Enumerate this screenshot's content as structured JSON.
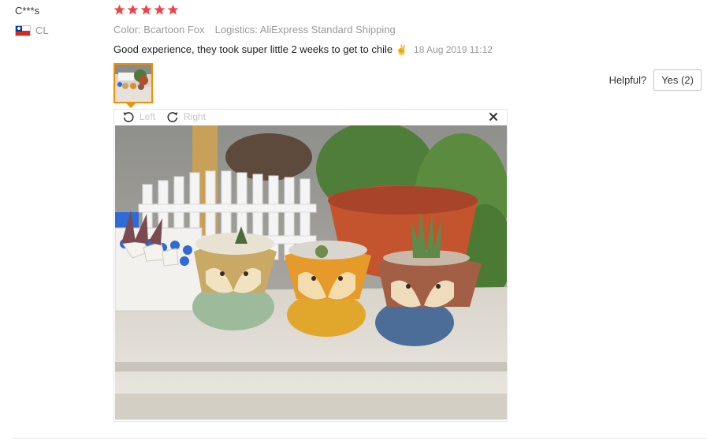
{
  "review": {
    "user_name": "C***s",
    "country_code": "CL",
    "rating": 5,
    "star_color": "#f0424b",
    "attributes": {
      "color": "Color: Bcartoon Fox",
      "logistics": "Logistics: AliExpress Standard Shipping"
    },
    "feedback_text": "Good experience, they took super little 2 weeks to get to chile",
    "feedback_emoji": "✌",
    "date": "18 Aug 2019 11:12",
    "helpful_label": "Helpful?",
    "yes_label": "Yes (2)"
  },
  "viewer": {
    "rotate_left_label": "Left",
    "rotate_right_label": "Right",
    "close_icon": "close-icon",
    "accent_color": "#f29100"
  }
}
